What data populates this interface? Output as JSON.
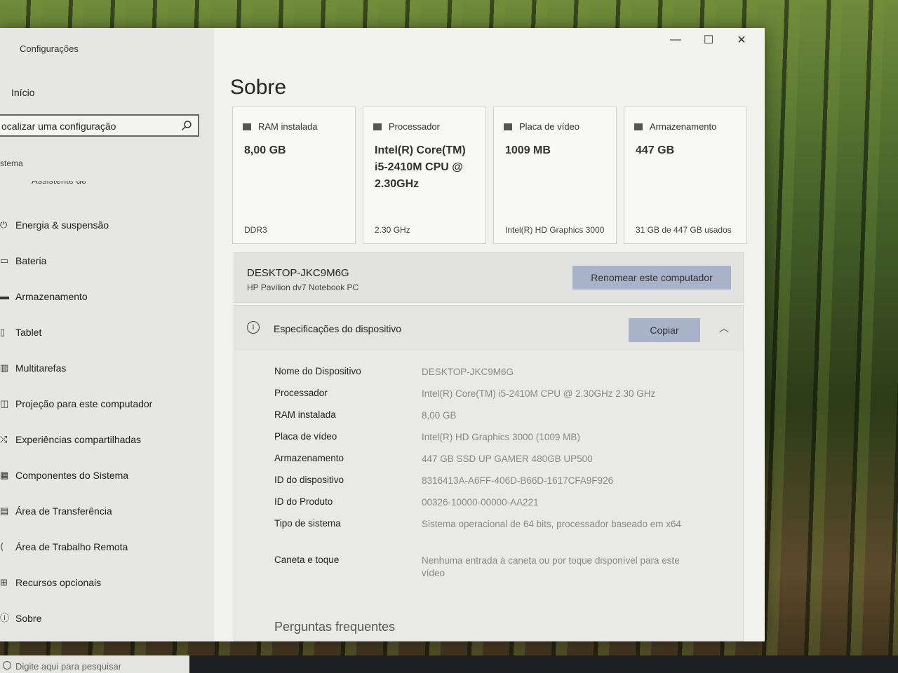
{
  "window": {
    "title": "Configurações"
  },
  "sidebar": {
    "home": "Início",
    "search_placeholder": "ocalizar uma configuração",
    "section": "stema",
    "partial_item": "Assistente de foco",
    "items": [
      {
        "label": "Energia & suspensão",
        "icon": "power-icon"
      },
      {
        "label": "Bateria",
        "icon": "battery-icon"
      },
      {
        "label": "Armazenamento",
        "icon": "storage-icon"
      },
      {
        "label": "Tablet",
        "icon": "tablet-icon"
      },
      {
        "label": "Multitarefas",
        "icon": "multitask-icon"
      },
      {
        "label": "Projeção para este computador",
        "icon": "projection-icon"
      },
      {
        "label": "Experiências compartilhadas",
        "icon": "shared-icon"
      },
      {
        "label": "Componentes do Sistema",
        "icon": "components-icon"
      },
      {
        "label": "Área de Transferência",
        "icon": "clipboard-icon"
      },
      {
        "label": "Área de Trabalho Remota",
        "icon": "remote-icon"
      },
      {
        "label": "Recursos opcionais",
        "icon": "features-icon"
      },
      {
        "label": "Sobre",
        "icon": "info-icon"
      }
    ]
  },
  "window_controls": {
    "minimize": "—",
    "maximize": "☐",
    "close": "✕"
  },
  "page_title": "Sobre",
  "cards": [
    {
      "title": "RAM instalada",
      "value": "8,00 GB",
      "sub": "DDR3"
    },
    {
      "title": "Processador",
      "value": "Intel(R) Core(TM) i5-2410M CPU @ 2.30GHz",
      "sub": "2.30 GHz"
    },
    {
      "title": "Placa de vídeo",
      "value": "1009 MB",
      "sub": "Intel(R) HD Graphics 3000"
    },
    {
      "title": "Armazenamento",
      "value": "447 GB",
      "sub": "31 GB de 447 GB usados"
    }
  ],
  "computer": {
    "name": "DESKTOP-JKC9M6G",
    "model": "HP Pavilion dv7 Notebook PC",
    "rename_label": "Renomear este computador"
  },
  "specs": {
    "title": "Especificações do dispositivo",
    "copy_label": "Copiar",
    "rows": [
      {
        "k": "Nome do Dispositivo",
        "v": "DESKTOP-JKC9M6G"
      },
      {
        "k": "Processador",
        "v": "Intel(R) Core(TM) i5-2410M CPU @ 2.30GHz   2.30 GHz"
      },
      {
        "k": "RAM instalada",
        "v": "8,00 GB"
      },
      {
        "k": "Placa de vídeo",
        "v": "Intel(R) HD Graphics 3000 (1009 MB)"
      },
      {
        "k": "Armazenamento",
        "v": "447 GB SSD UP GAMER 480GB UP500"
      },
      {
        "k": "ID do dispositivo",
        "v": "8316413A-A6FF-406D-B66D-1617CFA9F926"
      },
      {
        "k": "ID do Produto",
        "v": "00326-10000-00000-AA221"
      },
      {
        "k": "Tipo de sistema",
        "v": "Sistema operacional de 64 bits, processador baseado em x64"
      },
      {
        "k": "Caneta e toque",
        "v": "Nenhuma entrada à caneta ou por toque disponível para este vídeo"
      }
    ],
    "faq": "Perguntas frequentes"
  },
  "taskbar": {
    "search_placeholder": "Digite aqui para pesquisar"
  }
}
